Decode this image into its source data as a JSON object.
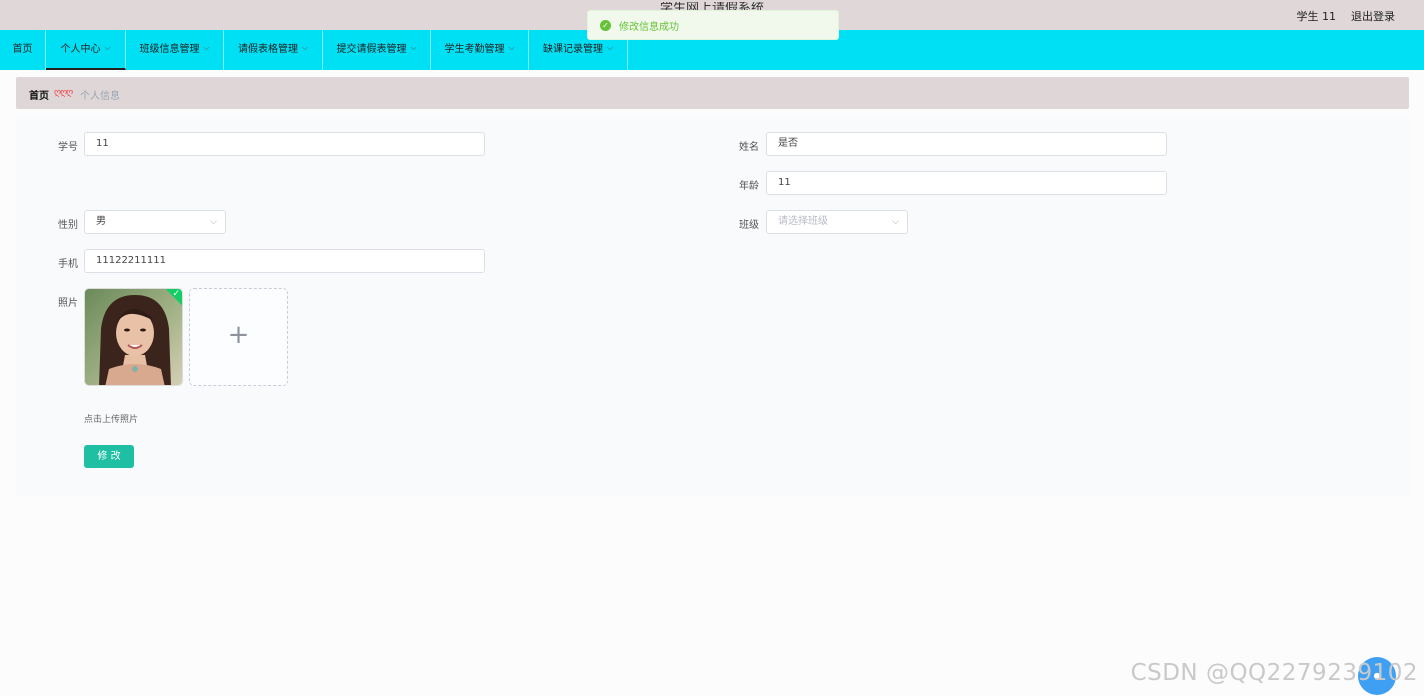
{
  "header": {
    "title": "学生网上请假系统",
    "user": "学生 11",
    "logout": "退出登录"
  },
  "toast": {
    "message": "修改信息成功"
  },
  "nav": {
    "items": [
      {
        "label": "首页"
      },
      {
        "label": "个人中心"
      },
      {
        "label": "班级信息管理"
      },
      {
        "label": "请假表格管理"
      },
      {
        "label": "提交请假表管理"
      },
      {
        "label": "学生考勤管理"
      },
      {
        "label": "缺课记录管理"
      }
    ]
  },
  "breadcrumb": {
    "home": "首页",
    "separator": "ღღღ",
    "current": "个人信息"
  },
  "form": {
    "student_id_label": "学号",
    "student_id_value": "11",
    "name_label": "姓名",
    "name_value": "是否",
    "age_label": "年龄",
    "age_value": "11",
    "gender_label": "性别",
    "gender_value": "男",
    "class_label": "班级",
    "class_placeholder": "请选择班级",
    "phone_label": "手机",
    "phone_value": "11122211111",
    "photo_label": "照片",
    "upload_tip": "点击上传照片",
    "submit_label": "修 改"
  },
  "watermark": "CSDN @QQ2279239102",
  "colors": {
    "nav_bg": "#00e0f4",
    "header_bg": "#e0d8d8",
    "button": "#1fbfa3",
    "success": "#67c23a"
  }
}
